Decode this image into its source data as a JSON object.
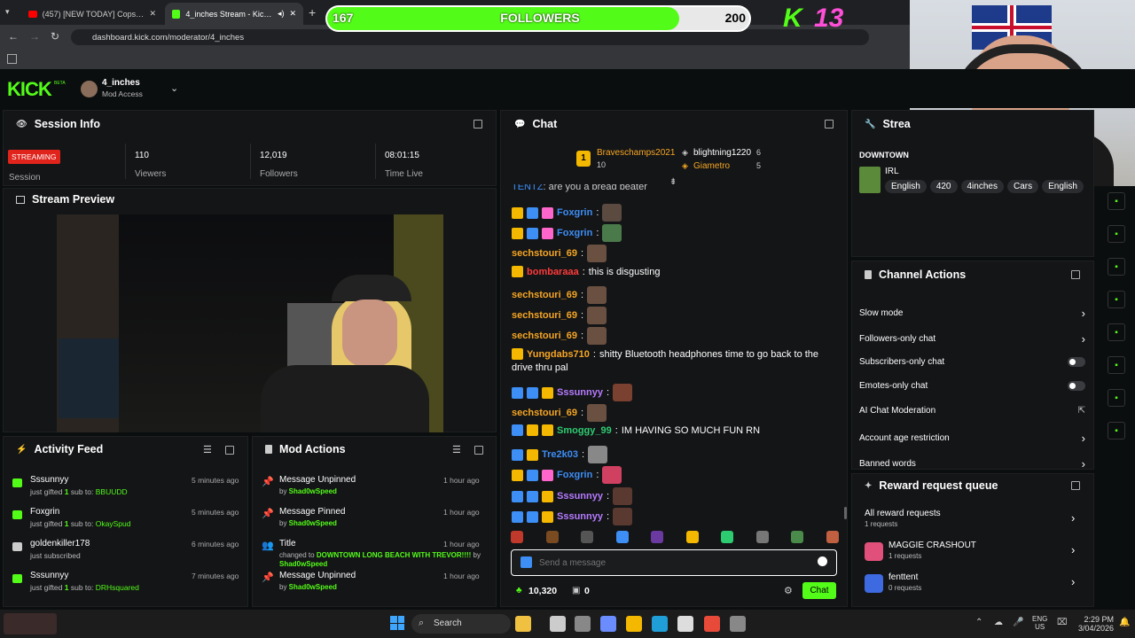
{
  "browser": {
    "tabs": [
      {
        "label": "(457) [NEW TODAY] Cops Reloa"
      },
      {
        "label": "4_inches Stream - Kick Dash"
      }
    ],
    "url": "dashboard.kick.com/moderator/4_inches"
  },
  "overlay": {
    "followers_current": "167",
    "followers_label": "FOLLOWERS",
    "followers_goal": "200",
    "followers_progress": 0.835,
    "kick_count": "13"
  },
  "header": {
    "logo": "KICK",
    "logo_tag": "BETA",
    "channel": "4_inches",
    "role": "Mod Access"
  },
  "session": {
    "title": "Session Info",
    "status": "STREAMING",
    "status_label": "Session",
    "viewers": "110",
    "viewers_label": "Viewers",
    "followers": "12,019",
    "followers_label": "Followers",
    "time": "08:01:15",
    "time_label": "Time Live"
  },
  "preview": {
    "title": "Stream Preview"
  },
  "activity": {
    "title": "Activity Feed",
    "items": [
      {
        "name": "Sssunnyy",
        "pre": "just gifted ",
        "count": "1",
        "mid": " sub to: ",
        "target": "BBUUDD",
        "time": "5 minutes ago"
      },
      {
        "name": "Foxgrin",
        "pre": "just gifted ",
        "count": "1",
        "mid": " sub to: ",
        "target": "OkaySpud",
        "time": "5 minutes ago"
      },
      {
        "name": "goldenkiller178",
        "pre": "just subscribed",
        "count": "",
        "mid": "",
        "target": "",
        "time": "6 minutes ago"
      },
      {
        "name": "Sssunnyy",
        "pre": "just gifted ",
        "count": "1",
        "mid": " sub to: ",
        "target": "DRHsquared",
        "time": "7 minutes ago"
      }
    ]
  },
  "modactions": {
    "title": "Mod Actions",
    "items": [
      {
        "title": "Message Unpinned",
        "line1": "by ",
        "line1b": "Shad0wSpeed",
        "line2": "",
        "time": "1 hour ago"
      },
      {
        "title": "Message Pinned",
        "line1": "by ",
        "line1b": "Shad0wSpeed",
        "line2": "",
        "time": "1 hour ago"
      },
      {
        "title": "Title",
        "line1": "changed to ",
        "line1b": "DOWNTOWN LONG BEACH WITH TREVOR!!!!",
        "line1c": " by",
        "line2": "Shad0wSpeed",
        "time": "1 hour ago"
      },
      {
        "title": "Message Unpinned",
        "line1": "by ",
        "line1b": "Shad0wSpeed",
        "line2": "",
        "time": "1 hour ago"
      }
    ]
  },
  "chat": {
    "title": "Chat",
    "top": [
      {
        "rank": "1",
        "name": "Braveschamps2021",
        "count": "10"
      },
      {
        "name": "blightning1220",
        "count": "6"
      },
      {
        "name": "Giametro",
        "count": "5"
      }
    ],
    "partial_line": "are you a bread beater",
    "partial_user": "TENTZ",
    "messages": [
      {
        "user": "Foxgrin",
        "color": "#3d8ef5",
        "text": ""
      },
      {
        "user": "Foxgrin",
        "color": "#3d8ef5",
        "text": ""
      },
      {
        "user": "sechstouri_69",
        "color": "#f5a623",
        "text": ""
      },
      {
        "user": "bombaraaa",
        "color": "#ff3b3b",
        "text": "this is disgusting"
      },
      {
        "user": "sechstouri_69",
        "color": "#f5a623",
        "text": ""
      },
      {
        "user": "sechstouri_69",
        "color": "#f5a623",
        "text": ""
      },
      {
        "user": "sechstouri_69",
        "color": "#f5a623",
        "text": ""
      },
      {
        "user": "Yungdabs710",
        "color": "#f5a623",
        "text": "shitty Bluetooth headphones time to go back to the",
        "text2": "drive thru pal"
      },
      {
        "user": "Sssunnyy",
        "color": "#b57bff",
        "text": ""
      },
      {
        "user": "sechstouri_69",
        "color": "#f5a623",
        "text": ""
      },
      {
        "user": "Smoggy_99",
        "color": "#2ecc71",
        "text": "IM HAVING SO MUCH FUN RN"
      },
      {
        "user": "Tre2k03",
        "color": "#3d8ef5",
        "text": ""
      },
      {
        "user": "Foxgrin",
        "color": "#3d8ef5",
        "text": ""
      },
      {
        "user": "Sssunnyy",
        "color": "#b57bff",
        "text": ""
      },
      {
        "user": "Sssunnyy",
        "color": "#b57bff",
        "text": ""
      }
    ],
    "placeholder": "Send a message",
    "points": "10,320",
    "store": "0",
    "send": "Chat"
  },
  "stream_info": {
    "title": "Strea",
    "stream_title": "DOWNTOWN",
    "category": "IRL",
    "tags": [
      "English",
      "420",
      "4inches",
      "Cars",
      "English"
    ]
  },
  "channel_actions": {
    "title": "Channel Actions",
    "items": [
      {
        "label": "Slow mode",
        "kind": "chevron"
      },
      {
        "label": "Followers-only chat",
        "kind": "chevron"
      },
      {
        "label": "Subscribers-only chat",
        "kind": "toggle"
      },
      {
        "label": "Emotes-only chat",
        "kind": "toggle"
      },
      {
        "label": "AI Chat Moderation",
        "kind": "external"
      },
      {
        "label": "Account age restriction",
        "kind": "chevron"
      },
      {
        "label": "Banned words",
        "kind": "chevron"
      }
    ]
  },
  "rewards": {
    "title": "Reward request queue",
    "items": [
      {
        "label": "All reward requests",
        "sub": "1 requests"
      },
      {
        "label": "MAGGIE CRASHOUT",
        "sub": "1 requests"
      },
      {
        "label": "fenttent",
        "sub": "0 requests"
      }
    ]
  },
  "taskbar": {
    "search": "Search",
    "lang": "ENG",
    "region": "US",
    "time": "2:29 PM",
    "date": "3/04/2026"
  }
}
